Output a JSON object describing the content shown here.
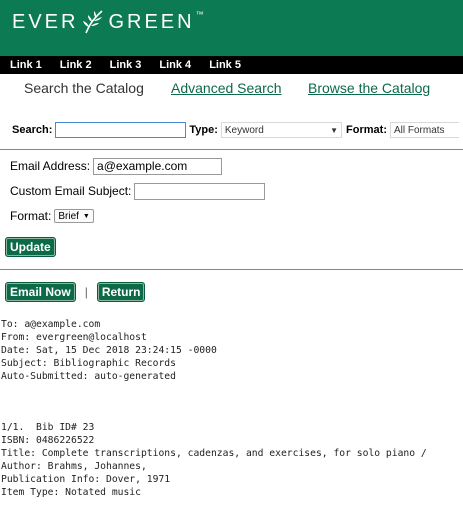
{
  "brand": {
    "logo_left": "EVER",
    "logo_right": "GREEN",
    "trademark": "™"
  },
  "nav": {
    "links": [
      "Link 1",
      "Link 2",
      "Link 3",
      "Link 4",
      "Link 5"
    ]
  },
  "tabs": {
    "search": "Search the Catalog",
    "advanced": "Advanced Search",
    "browse": "Browse the Catalog"
  },
  "searchbar": {
    "search_label": "Search:",
    "search_value": "",
    "type_label": "Type:",
    "type_value": "Keyword",
    "format_label": "Format:",
    "format_value": "All Formats"
  },
  "form": {
    "email_label": "Email Address:",
    "email_value": "a@example.com",
    "subject_label": "Custom Email Subject:",
    "subject_value": "",
    "format_label": "Format:",
    "format_value": "Brief",
    "update_label": "Update"
  },
  "actions": {
    "email_now": "Email Now",
    "separator": "|",
    "return": "Return"
  },
  "email": {
    "headers": [
      "To: a@example.com",
      "From: evergreen@localhost",
      "Date: Sat, 15 Dec 2018 23:24:15 -0000",
      "Subject: Bibliographic Records",
      "Auto-Submitted: auto-generated"
    ],
    "record": [
      "1/1.  Bib ID# 23",
      "ISBN: 0486226522",
      "Title: Complete transcriptions, cadenzas, and exercises, for solo piano /",
      "Author: Brahms, Johannes,",
      "Publication Info: Dover, 1971",
      "Item Type: Notated music"
    ]
  },
  "colors": {
    "brand_green": "#0c7a52",
    "button_green": "#0c6a48",
    "nav_black": "#000000"
  }
}
